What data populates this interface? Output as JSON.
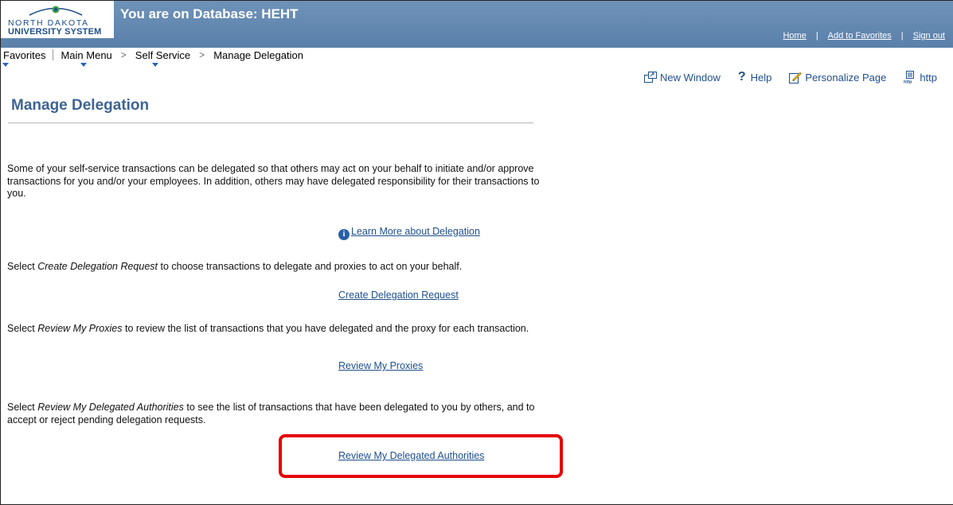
{
  "header": {
    "logo_line1": "NORTH DAKOTA",
    "logo_line2": "UNIVERSITY SYSTEM",
    "title": "You are on Database: HEHT",
    "links": [
      "Home",
      "Add to Favorites",
      "Sign out"
    ]
  },
  "nav": {
    "favorites": "Favorites",
    "main_menu": "Main Menu",
    "self_service": "Self Service",
    "manage_delegation": "Manage Delegation"
  },
  "toolbar": {
    "new_window": "New Window",
    "help": "Help",
    "personalize": "Personalize Page",
    "http": "http"
  },
  "page": {
    "title": "Manage Delegation",
    "intro": "Some of your self-service transactions can be delegated so that others may act on your behalf to initiate and/or approve transactions for you and/or your employees. In addition, others may have delegated responsibility for their transactions to you.",
    "learn_more": "Learn More about Delegation",
    "create_prefix": "Select ",
    "create_em": "Create Delegation Request",
    "create_suffix": " to choose transactions to delegate and proxies to act on your behalf.",
    "create_link": "Create Delegation Request",
    "proxies_prefix": "Select ",
    "proxies_em": "Review My Proxies",
    "proxies_suffix": " to review the list of transactions that you have delegated and the proxy for each transaction.",
    "proxies_link": "Review My Proxies",
    "authorities_prefix": "Select ",
    "authorities_em": "Review My Delegated Authorities",
    "authorities_suffix": " to see the list of transactions that have been delegated to you by others, and to accept or reject pending delegation requests.",
    "authorities_link": "Review My Delegated Authorities"
  },
  "colors": {
    "header_bg": "#5a80aa",
    "title": "#3d6494",
    "link": "#1e4f8e",
    "highlight": "#e60000"
  }
}
